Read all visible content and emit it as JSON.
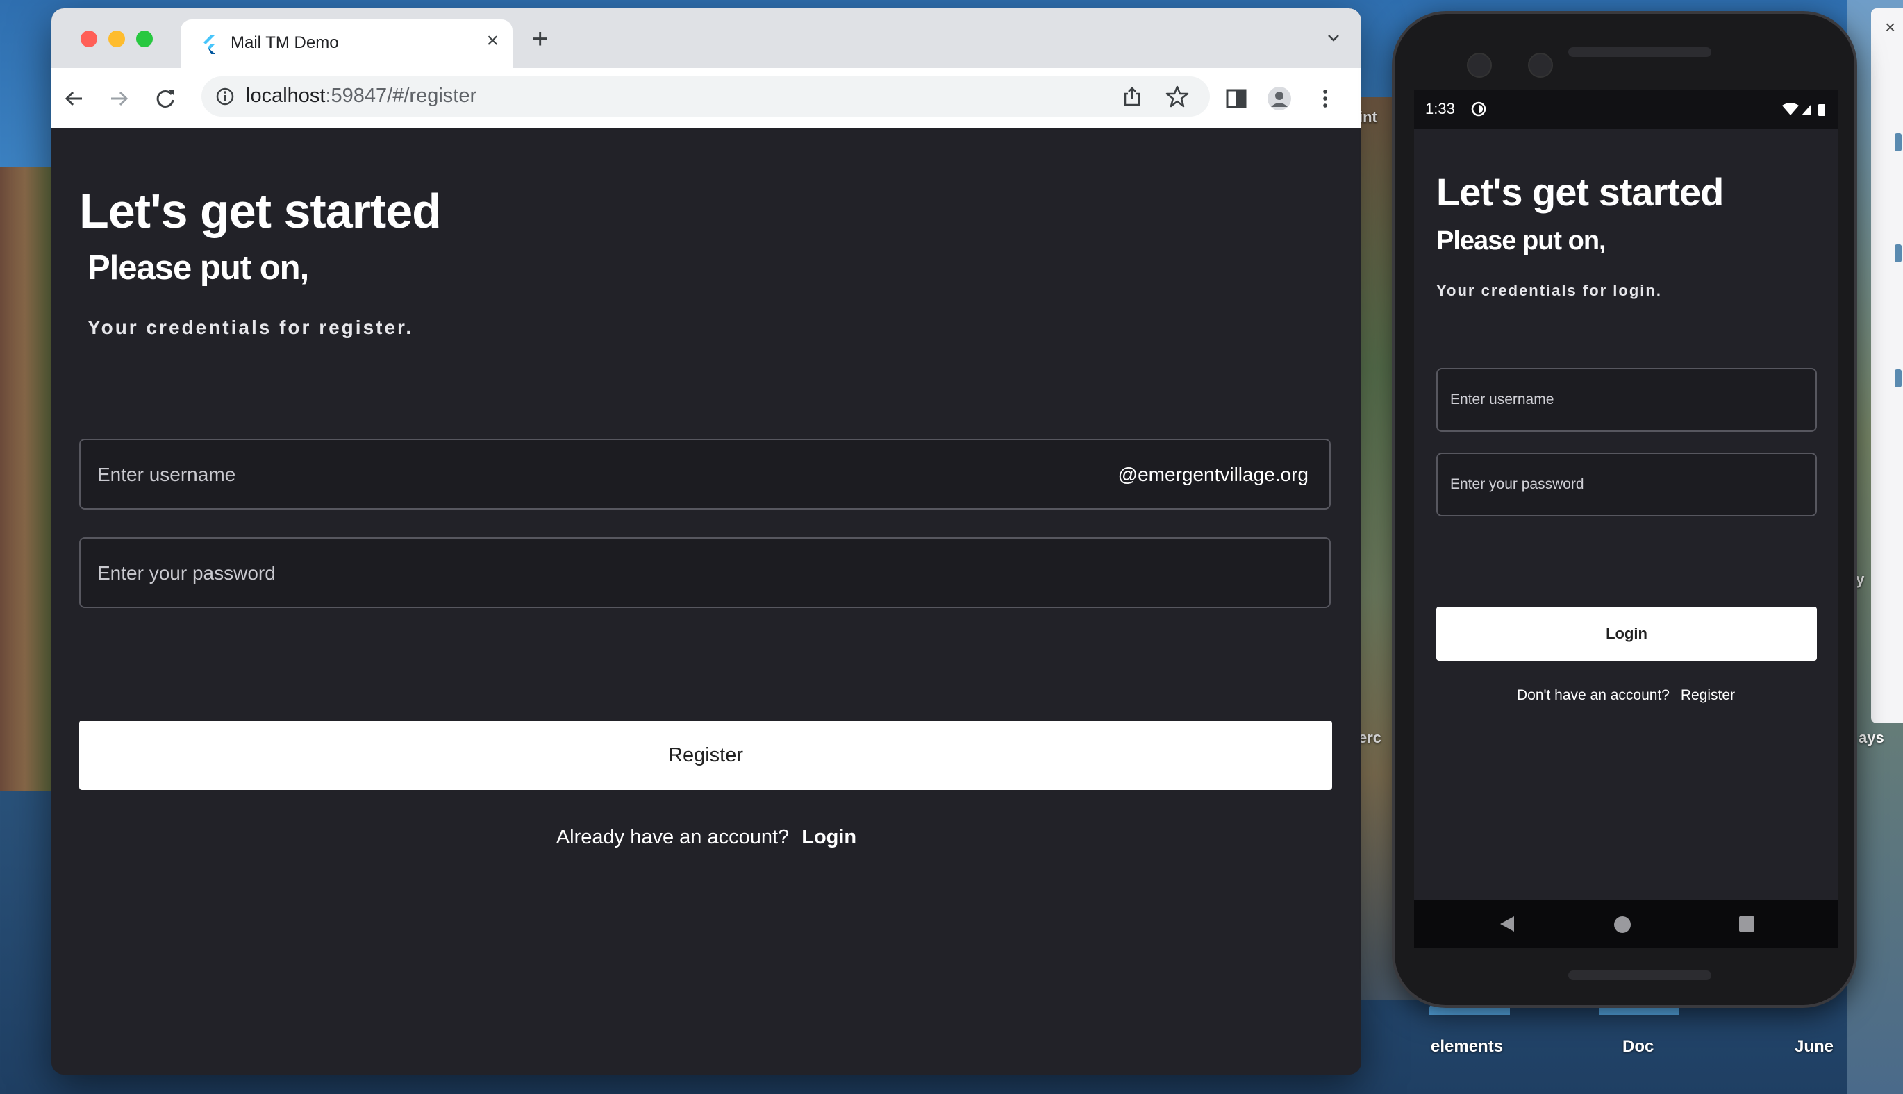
{
  "desktop": {
    "icons": [
      "elements",
      "Doc",
      "June"
    ],
    "partial_labels": [
      "int",
      "erc",
      "ays",
      "ıy"
    ]
  },
  "browser": {
    "tab_title": "Mail TM Demo",
    "new_tab_symbol": "+",
    "close_symbol": "×",
    "url_host": "localhost",
    "url_path": ":59847/#/register"
  },
  "web_page": {
    "heading": "Let's get started",
    "subheading": "Please put on,",
    "caption": "Your credentials for register.",
    "username_placeholder": "Enter username",
    "username_suffix": "@emergentvillage.org",
    "password_placeholder": "Enter your password",
    "button_label": "Register",
    "footer_text": "Already have an account?",
    "footer_link": "Login"
  },
  "phone": {
    "status_time": "1:33",
    "heading": "Let's get started",
    "subheading": "Please put on,",
    "caption": "Your credentials for login.",
    "username_placeholder": "Enter  username",
    "password_placeholder": "Enter your password",
    "button_label": "Login",
    "footer_text": "Don't have an account?",
    "footer_link": "Register"
  },
  "colors": {
    "page_bg": "#222228",
    "button_bg": "#ffffff",
    "input_border": "#57575f",
    "chrome_tab_bg": "#dfe1e5"
  }
}
